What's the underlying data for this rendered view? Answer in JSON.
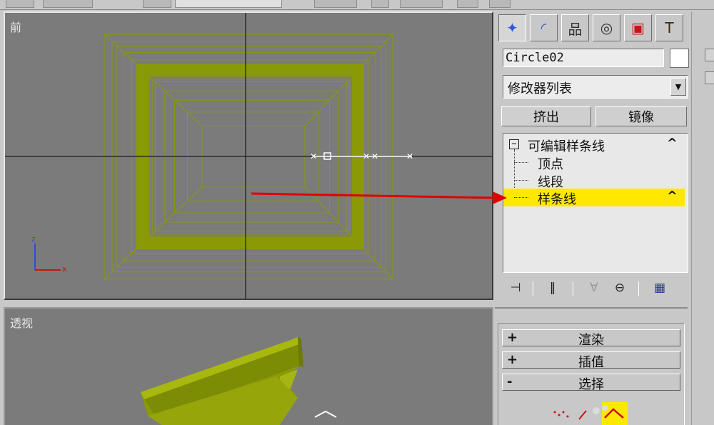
{
  "viewports": {
    "front": {
      "label": "前",
      "axis": {
        "z": "z",
        "x": "x"
      }
    },
    "perspective": {
      "label": "透视"
    }
  },
  "command_panel": {
    "tabs": [
      {
        "name": "create-tab",
        "icon": "create-icon",
        "active": true
      },
      {
        "name": "modify-tab",
        "icon": "modify-icon"
      },
      {
        "name": "hierarchy-tab",
        "icon": "hierarchy-icon"
      },
      {
        "name": "motion-tab",
        "icon": "motion-icon"
      },
      {
        "name": "display-tab",
        "icon": "display-icon"
      },
      {
        "name": "utilities-tab",
        "icon": "hammer-icon"
      }
    ],
    "object_name": "Circle02",
    "object_color": "#ffffff",
    "modifier_list": "修改器列表",
    "buttons": {
      "extrude": "挤出",
      "mirror": "镜像"
    },
    "stack": {
      "root": "可编辑样条线",
      "items": [
        "顶点",
        "线段",
        "样条线"
      ],
      "selected_item": "样条线",
      "selected_color": "#ffe800"
    },
    "rollouts": [
      {
        "sign": "+",
        "title": "渲染"
      },
      {
        "sign": "+",
        "title": "插值"
      },
      {
        "sign": "-",
        "title": "选择"
      }
    ]
  },
  "colors": {
    "wireframe": "#8a9a06",
    "viewport_bg": "#7b7b7b",
    "annotation_arrow": "#e00000"
  }
}
